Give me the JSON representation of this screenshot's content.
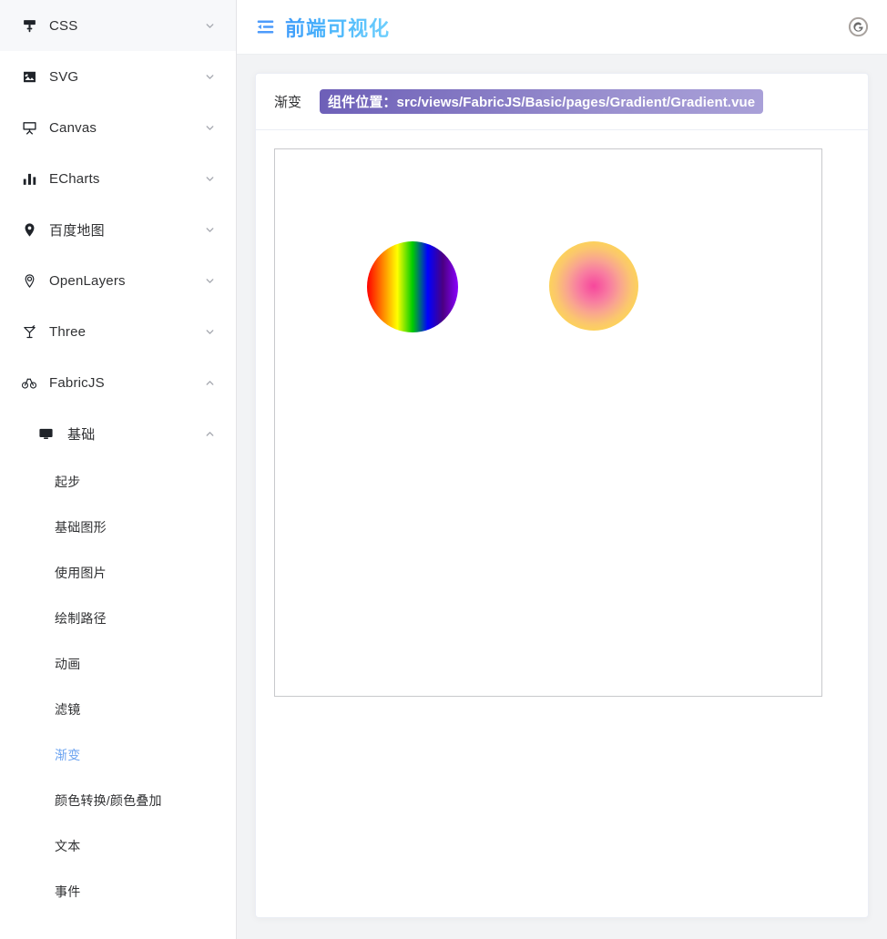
{
  "sidebar": {
    "items": [
      {
        "label": "CSS",
        "icon": "brush-icon",
        "chevron": "chevron-down-icon"
      },
      {
        "label": "SVG",
        "icon": "image-icon",
        "chevron": "chevron-down-icon"
      },
      {
        "label": "Canvas",
        "icon": "easel-icon",
        "chevron": "chevron-down-icon"
      },
      {
        "label": "ECharts",
        "icon": "bar-chart-icon",
        "chevron": "chevron-down-icon"
      },
      {
        "label": "百度地图",
        "icon": "map-pin-icon",
        "chevron": "chevron-down-icon"
      },
      {
        "label": "OpenLayers",
        "icon": "layers-pin-icon",
        "chevron": "chevron-down-icon"
      },
      {
        "label": "Three",
        "icon": "cocktail-icon",
        "chevron": "chevron-down-icon"
      },
      {
        "label": "FabricJS",
        "icon": "bicycle-icon",
        "chevron": "chevron-up-icon"
      }
    ],
    "fabricjs_group": {
      "label": "基础",
      "icon": "monitor-icon",
      "chevron": "chevron-up-icon",
      "children": [
        {
          "label": "起步",
          "active": false
        },
        {
          "label": "基础图形",
          "active": false
        },
        {
          "label": "使用图片",
          "active": false
        },
        {
          "label": "绘制路径",
          "active": false
        },
        {
          "label": "动画",
          "active": false
        },
        {
          "label": "滤镜",
          "active": false
        },
        {
          "label": "渐变",
          "active": true
        },
        {
          "label": "颜色转换/颜色叠加",
          "active": false
        },
        {
          "label": "文本",
          "active": false
        },
        {
          "label": "事件",
          "active": false
        }
      ]
    }
  },
  "topbar": {
    "fold_icon": "menu-fold-icon",
    "title": "前端可视化",
    "github_icon": "github-icon",
    "github_label": "G"
  },
  "card": {
    "title": "渐变",
    "path_badge": "组件位置：src/views/FabricJS/Basic/pages/Gradient/Gradient.vue"
  },
  "canvas": {
    "shapes": [
      {
        "name": "linear-gradient-circle",
        "type": "circle",
        "gradient": "linear",
        "stops": [
          "#ff0000",
          "#ff7f00",
          "#ffff00",
          "#00cc00",
          "#0000ff",
          "#4b0082",
          "#8b00ff"
        ]
      },
      {
        "name": "radial-gradient-circle",
        "type": "circle",
        "gradient": "radial",
        "stops": [
          "#f7479c",
          "#ffd93d"
        ]
      }
    ]
  },
  "colors": {
    "accent": "#6ba3f0",
    "title_gradient_start": "#3f9bfa",
    "title_gradient_end": "#6fd0fd",
    "badge_gradient_start": "#6d5fb8",
    "badge_gradient_end": "#a9a0d8",
    "sidebar_border": "#e4e4e7",
    "page_bg": "#f2f3f5"
  }
}
